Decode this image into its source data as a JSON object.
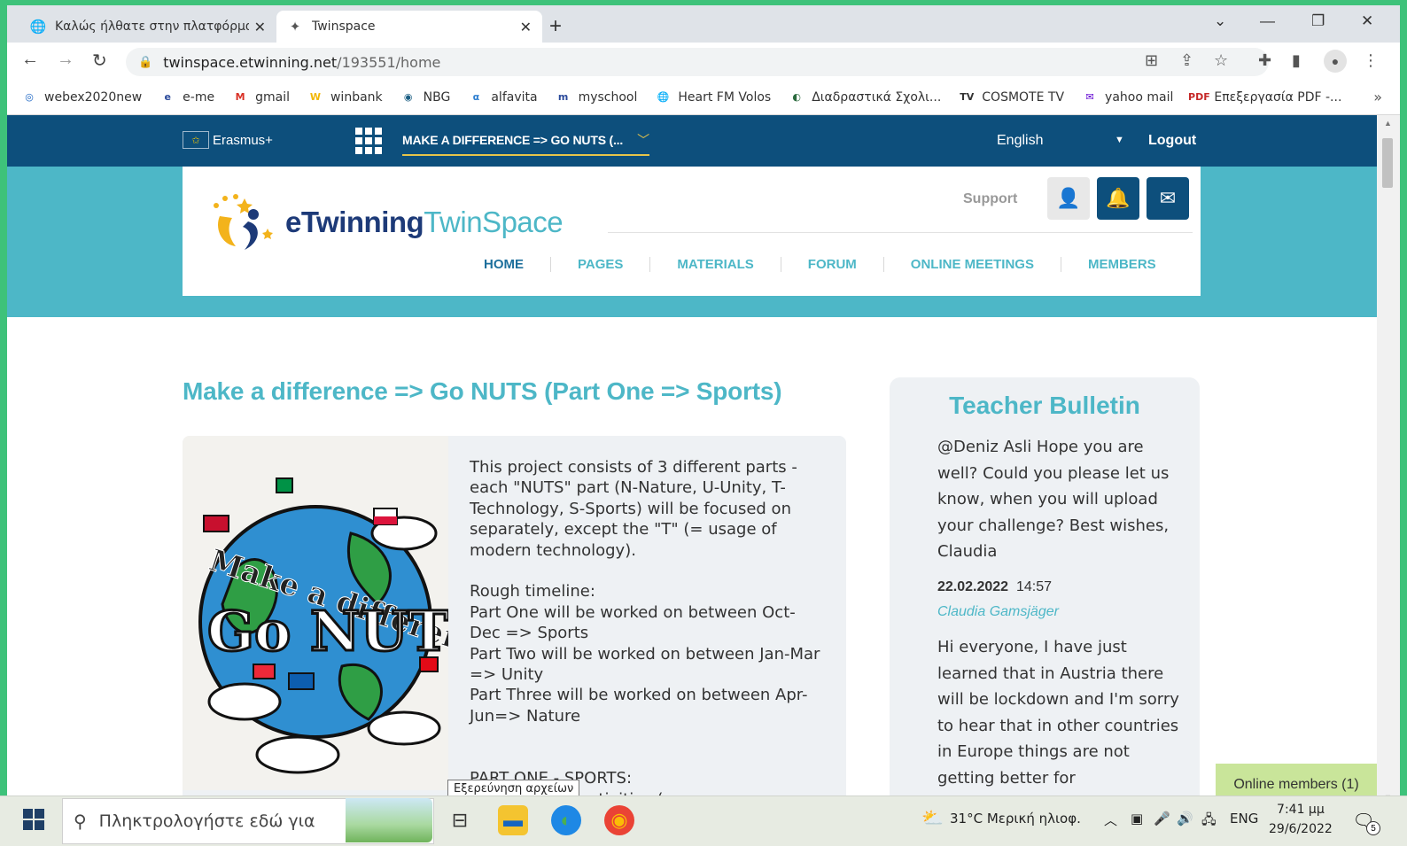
{
  "browser": {
    "tabs": [
      {
        "title": "Καλώς ήλθατε στην πλατφόρμα",
        "active": false
      },
      {
        "title": "Twinspace",
        "active": true
      }
    ],
    "new_tab": "+",
    "window_controls": {
      "list": "⌄",
      "minimize": "—",
      "restore": "❐",
      "close": "✕"
    },
    "url_host": "twinspace.etwinning.net",
    "url_path": "/193551/home",
    "bookmarks": [
      {
        "label": "webex2020new",
        "icon": "webex-icon",
        "color": "#1b65c4"
      },
      {
        "label": "e-me",
        "icon": "eme-icon",
        "color": "#2b4a9b"
      },
      {
        "label": "gmail",
        "icon": "gmail-icon",
        "color": "#d93025"
      },
      {
        "label": "winbank",
        "icon": "winbank-icon",
        "color": "#f2b705"
      },
      {
        "label": "NBG",
        "icon": "nbg-icon",
        "color": "#1b5e83"
      },
      {
        "label": "alfavita",
        "icon": "alfavita-icon",
        "color": "#2f7fd0"
      },
      {
        "label": "myschool",
        "icon": "myschool-icon",
        "color": "#2b4a9b"
      },
      {
        "label": "Heart FM Volos",
        "icon": "globe-icon",
        "color": "#555555"
      },
      {
        "label": "Διαδραστικά Σχολι...",
        "icon": "photodentro-icon",
        "color": "#2c6b3f"
      },
      {
        "label": "COSMOTE TV",
        "icon": "cosmote-icon",
        "color": "#333333"
      },
      {
        "label": "yahoo mail",
        "icon": "yahoo-icon",
        "color": "#6001d2"
      },
      {
        "label": "Επεξεργασία PDF -...",
        "icon": "pdf-icon",
        "color": "#c62828"
      }
    ],
    "bookmarks_more": "»"
  },
  "site": {
    "topbar": {
      "erasmus_label": "Erasmus+",
      "project_selector": "MAKE A DIFFERENCE => GO NUTS (...",
      "language": "English",
      "logout": "Logout"
    },
    "logo": {
      "part1": "eTwinning",
      "part2": "TwinSpace"
    },
    "support": "Support",
    "nav": [
      "HOME",
      "PAGES",
      "MATERIALS",
      "FORUM",
      "ONLINE MEETINGS",
      "MEMBERS"
    ],
    "page_title": "Make a difference => Go NUTS (Part One => Sports)",
    "image_text": {
      "line1": "Make a difference",
      "line2": "Go NUTS"
    },
    "description": "This project consists of 3 different parts - each \"NUTS\" part (N-Nature, U-Unity, T-Technology, S-Sports) will be focused on separately, except the \"T\" (= usage of modern technology).\n\nRough timeline:\nPart One will be worked on between Oct-Dec => Sports\nPart Two will be worked on between Jan-Mar => Unity\nPart Three will be worked on between Apr-Jun=> Nature\n\n\nPART ONE - SPORTS:\n... ong sitting activities (e.g.",
    "bulletin": {
      "title": "Teacher Bulletin",
      "message1": "@Deniz Asli Hope you are well? Could you please let us know, when you will upload your challenge? Best wishes, Claudia",
      "date": "22.02.2022",
      "time": "14:57",
      "author": "Claudia Gamsjäger",
      "message2": "Hi everyone, I have just learned that in Austria there will be lockdown and I'm sorry to hear that in other countries in Europe things are not getting better for"
    },
    "online_members": "Online members (1)",
    "tooltip": "Εξερεύνηση αρχείων"
  },
  "taskbar": {
    "search_placeholder": "Πληκτρολογήστε εδώ για",
    "weather": "31°C  Μερική ηλιοφ.",
    "language": "ENG",
    "time": "7:41 μμ",
    "date": "29/6/2022",
    "notifications": "5"
  },
  "colors": {
    "brand_dark": "#0d4f7c",
    "brand_teal": "#4db7c7",
    "accent_yellow": "#e6c44a",
    "online_green": "#c9e59a",
    "outer_green": "#3ec27a"
  }
}
